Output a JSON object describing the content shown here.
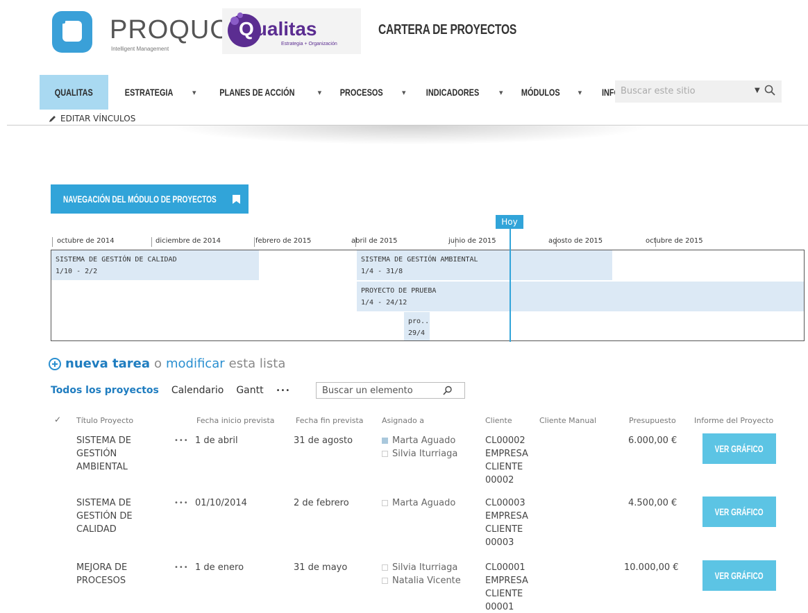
{
  "header": {
    "brand_name": "PROQUO",
    "brand_tagline": "Intelligent Management",
    "partner_name": "ualitas",
    "partner_initial": "Q",
    "partner_tagline": "Estrategia + Organización",
    "site_title": "CARTERA DE PROYECTOS"
  },
  "nav": {
    "items": [
      {
        "label": "QUALITAS",
        "selected": true,
        "dropdown": false
      },
      {
        "label": "ESTRATEGIA",
        "dropdown": true
      },
      {
        "label": "PLANES DE ACCIÓN",
        "dropdown": true
      },
      {
        "label": "PROCESOS",
        "dropdown": true
      },
      {
        "label": "INDICADORES",
        "dropdown": true
      },
      {
        "label": "MÓDULOS",
        "dropdown": true
      },
      {
        "label": "INFO PROQUO",
        "dropdown": false
      }
    ],
    "search_placeholder": "Buscar este sitio",
    "edit_links": "EDITAR VÍNCULOS"
  },
  "module_nav_button": "NAVEGACIÓN DEL MÓDULO DE PROYECTOS",
  "timeline": {
    "today_label": "Hoy",
    "months": [
      "octubre de 2014",
      "diciembre de 2014",
      "febrero de 2015",
      "abril de 2015",
      "junio de 2015",
      "agosto de 2015",
      "octubre de 2015"
    ],
    "bars": [
      {
        "title": "SISTEMA DE GESTIÓN DE CALIDAD",
        "dates": "1/10 - 2/2"
      },
      {
        "title": "SISTEMA DE GESTIÓN AMBIENTAL",
        "dates": "1/4 - 31/8"
      },
      {
        "title": "PROYECTO DE PRUEBA",
        "dates": "1/4 - 24/12"
      },
      {
        "title": "pro...",
        "dates": "29/4 -"
      }
    ]
  },
  "list": {
    "new_task": "nueva tarea",
    "or": "o",
    "modify": "modificar",
    "this_list": "esta lista",
    "views": [
      "Todos los proyectos",
      "Calendario",
      "Gantt"
    ],
    "more": "•••",
    "search_placeholder": "Buscar un elemento",
    "columns": [
      "Título Proyecto",
      "Fecha inicio prevista",
      "Fecha fin prevista",
      "Asignado a",
      "Cliente",
      "Cliente Manual",
      "Presupuesto",
      "Informe del Proyecto"
    ],
    "check_glyph": "✓",
    "rows": [
      {
        "title": "SISTEMA DE GESTIÓN AMBIENTAL",
        "start": "1 de abril",
        "end": "31 de agosto",
        "assigned": [
          "Marta Aguado",
          "Silvia Iturriaga"
        ],
        "client": "CL00002 EMPRESA CLIENTE 00002",
        "budget": "6.000,00 €",
        "report": "VER GRÁFICO"
      },
      {
        "title": "SISTEMA DE GESTIÓN DE CALIDAD",
        "start": "01/10/2014",
        "end": "2 de febrero",
        "assigned": [
          "Marta Aguado"
        ],
        "client": "CL00003 EMPRESA CLIENTE 00003",
        "budget": "4.500,00 €",
        "report": "VER GRÁFICO"
      },
      {
        "title": "MEJORA DE PROCESOS",
        "start": "1 de enero",
        "end": "31 de mayo",
        "assigned": [
          "Silvia Iturriaga",
          "Natalia Vicente"
        ],
        "client": "CL00001 EMPRESA CLIENTE 00001",
        "budget": "10.000,00 €",
        "report": "VER GRÁFICO"
      }
    ]
  },
  "colors": {
    "accent": "#31a4d9",
    "nav_selected": "#a9d9f1",
    "bar_fill": "#dce9f5",
    "partner": "#5b2d91"
  }
}
